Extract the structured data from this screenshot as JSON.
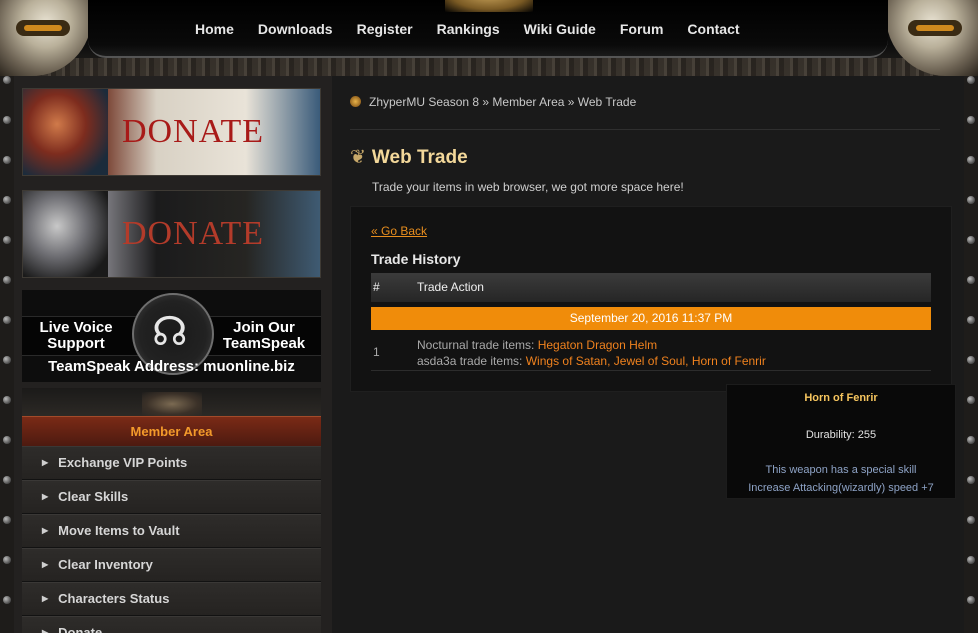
{
  "nav": {
    "items": [
      "Home",
      "Downloads",
      "Register",
      "Rankings",
      "Wiki Guide",
      "Forum",
      "Contact"
    ]
  },
  "banners": {
    "donate_1": "DONATE",
    "donate_2": "DONATE"
  },
  "teamspeak": {
    "live_1": "Live Voice",
    "live_2": "Support",
    "join_1": "Join Our",
    "join_2": "TeamSpeak",
    "address": "TeamSpeak Address: muonline.biz"
  },
  "sidebar": {
    "header": "Member Area",
    "items": [
      "Exchange VIP Points",
      "Clear Skills",
      "Move Items to Vault",
      "Clear Inventory",
      "Characters Status",
      "Donate"
    ]
  },
  "breadcrumb": {
    "text": "ZhyperMU Season 8 » Member Area » Web Trade"
  },
  "page": {
    "title": "Web Trade",
    "subtitle": "Trade your items in web browser, we got more space here!",
    "go_back": "« Go Back",
    "history_title": "Trade History"
  },
  "table": {
    "col_num": "#",
    "col_action": "Trade Action",
    "date": "September 20, 2016 11:37 PM",
    "row_num": "1",
    "line1_prefix": "Nocturnal trade items: ",
    "line1_items": "Hegaton Dragon Helm",
    "line2_prefix": "asda3a trade items: ",
    "line2_items": "Wings of Satan, Jewel of Soul, Horn of Fenrir"
  },
  "tooltip": {
    "title": "Horn of Fenrir",
    "durability": "Durability: 255",
    "skill": "This weapon has a special skill",
    "increase": "Increase Attacking(wizardly) speed +7"
  },
  "colors": {
    "accent": "#f08c0a",
    "link": "#f0821e",
    "title": "#f3d89a"
  }
}
